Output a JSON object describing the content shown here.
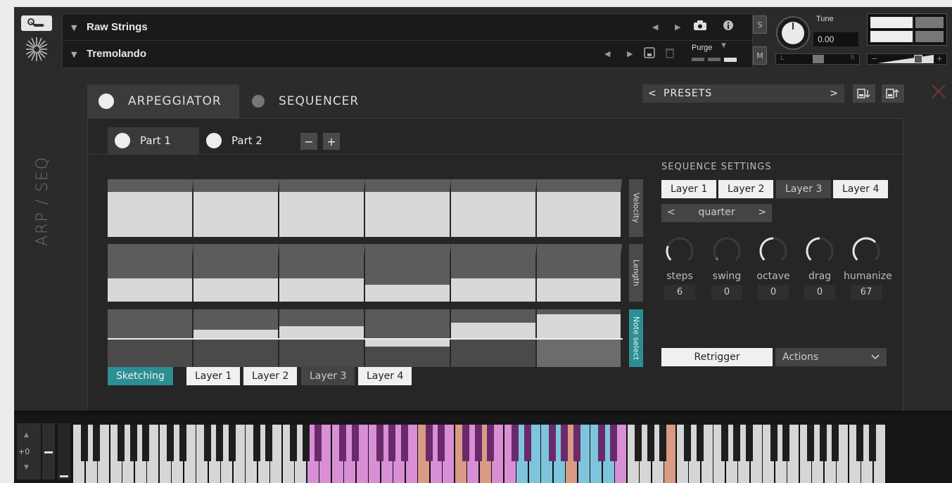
{
  "header": {
    "instrument_name": "Raw Strings",
    "articulation": "Tremolando",
    "purge_label": "Purge",
    "solo_label": "S",
    "mute_label": "M",
    "tune_label": "Tune",
    "tune_value": "0.00",
    "pan_left": "L",
    "pan_right": "R",
    "vol_minus": "−",
    "vol_plus": "+"
  },
  "side_label": "ARP / SEQ",
  "modes": {
    "arp_label": "ARPEGGIATOR",
    "seq_label": "SEQUENCER",
    "active": "arpeggiator"
  },
  "presets": {
    "label": "PRESETS",
    "prev": "<",
    "next": ">"
  },
  "parts": {
    "items": [
      {
        "label": "Part 1"
      },
      {
        "label": "Part 2"
      }
    ],
    "minus": "−",
    "plus": "+"
  },
  "rows": {
    "velocity_label": "Velocity",
    "length_label": "Length",
    "noteselect_label": "Note select",
    "velocity_levels": [
      0.8,
      0.8,
      0.8,
      0.8,
      0.8,
      0.8
    ],
    "length_levels": [
      0.52,
      0.52,
      0.52,
      0.38,
      0.52,
      0.52
    ],
    "noteselect_levels": [
      0.0,
      0.18,
      0.26,
      -0.18,
      0.34,
      0.52
    ]
  },
  "bottom_buttons": {
    "sketching": "Sketching",
    "layers": [
      "Layer 1",
      "Layer 2",
      "Layer 3",
      "Layer 4"
    ]
  },
  "sequence_settings": {
    "title": "SEQUENCE SETTINGS",
    "layers": [
      "Layer 1",
      "Layer 2",
      "Layer 3",
      "Layer 4"
    ],
    "resolution": "quarter",
    "knobs": [
      {
        "label": "steps",
        "value": "6",
        "level": 0.25
      },
      {
        "label": "swing",
        "value": "0",
        "level": 0.0
      },
      {
        "label": "octave",
        "value": "0",
        "level": 0.5
      },
      {
        "label": "drag",
        "value": "0",
        "level": 0.5
      },
      {
        "label": "humanize",
        "value": "67",
        "level": 0.67
      }
    ],
    "retrigger_label": "Retrigger",
    "actions_label": "Actions"
  },
  "keyboard": {
    "transpose": "+0",
    "colors": {
      "range": "#d88fd6",
      "active": "#7fc4dd",
      "marked": "#d99a86"
    }
  }
}
